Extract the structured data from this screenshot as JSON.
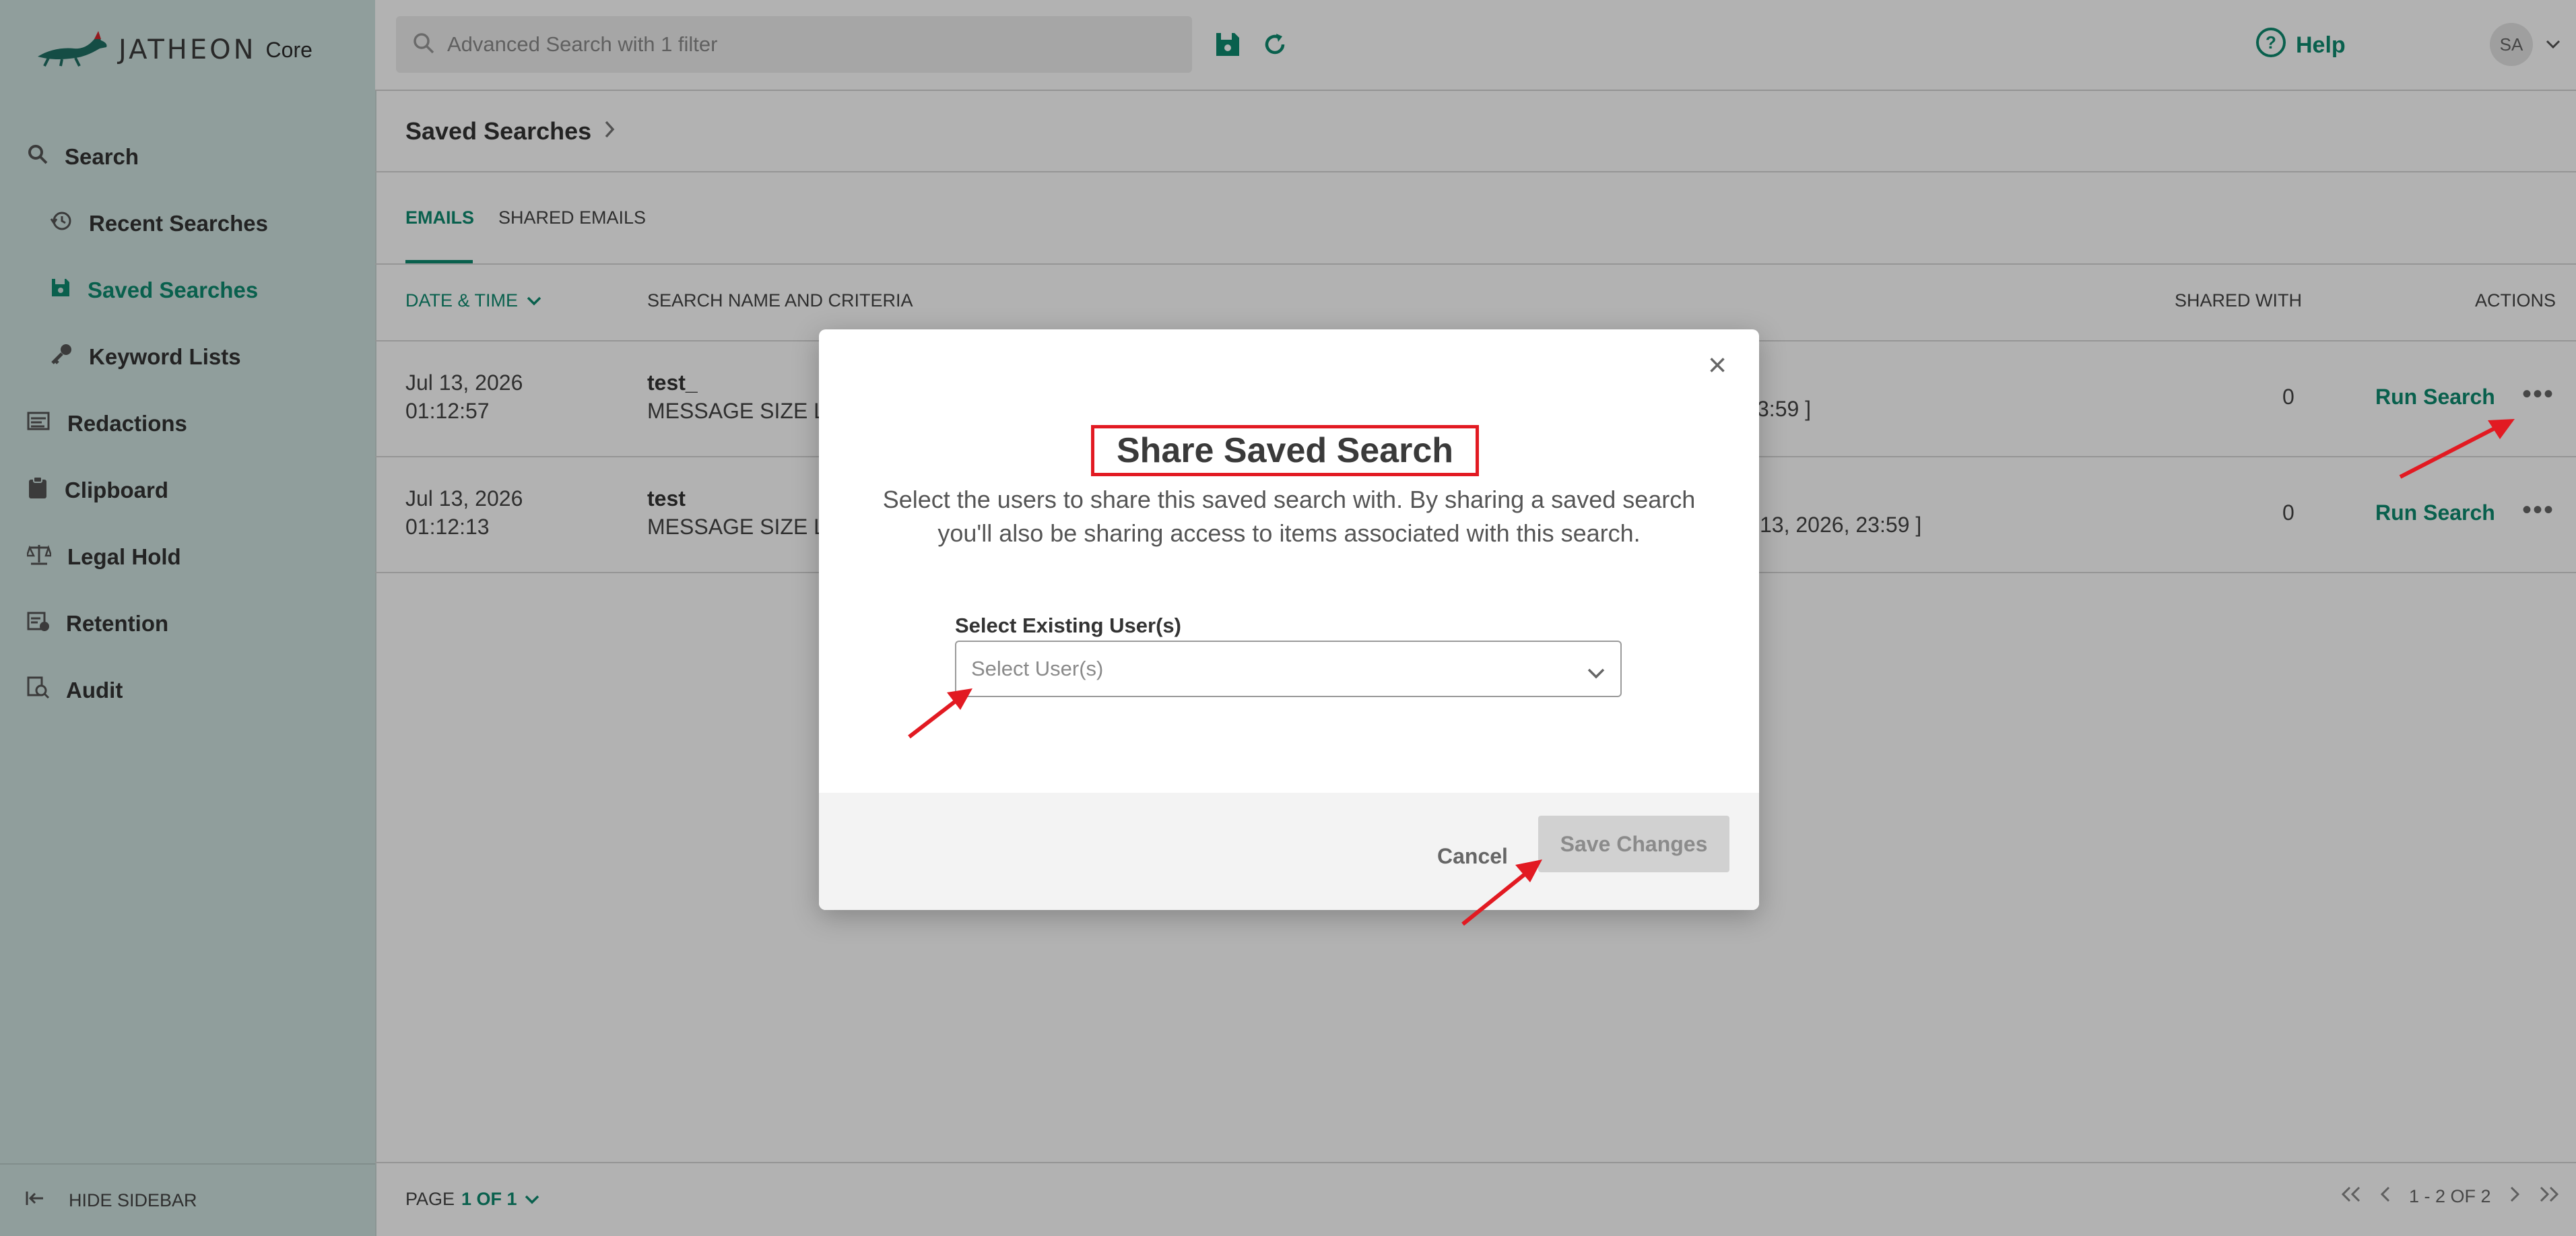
{
  "app": {
    "brand": "JATHEON",
    "product": "Core"
  },
  "sidebar": {
    "items": [
      {
        "label": "Search",
        "icon": "search-icon"
      },
      {
        "label": "Recent Searches",
        "icon": "history-icon"
      },
      {
        "label": "Saved Searches",
        "icon": "save-icon",
        "active": true
      },
      {
        "label": "Keyword Lists",
        "icon": "key-icon"
      },
      {
        "label": "Redactions",
        "icon": "redaction-icon"
      },
      {
        "label": "Clipboard",
        "icon": "clipboard-icon"
      },
      {
        "label": "Legal Hold",
        "icon": "scale-icon"
      },
      {
        "label": "Retention",
        "icon": "retention-icon"
      },
      {
        "label": "Audit",
        "icon": "audit-icon"
      }
    ],
    "hide_label": "HIDE SIDEBAR"
  },
  "topbar": {
    "search_placeholder": "Advanced Search with 1 filter",
    "help_label": "Help",
    "avatar_initials": "SA"
  },
  "breadcrumb": {
    "title": "Saved Searches"
  },
  "tabs": [
    {
      "label": "EMAILS",
      "active": true
    },
    {
      "label": "SHARED EMAILS",
      "active": false
    }
  ],
  "table": {
    "headers": {
      "date": "DATE & TIME",
      "name": "SEARCH NAME AND CRITERIA",
      "shared": "SHARED WITH",
      "actions": "ACTIONS"
    },
    "rows": [
      {
        "date": "Jul 13, 2026",
        "time": "01:12:57",
        "name": "test_",
        "criteria_head": "MESSAGE SIZE La",
        "criteria_tail": "3:59 ]",
        "shared": "0",
        "action": "Run Search"
      },
      {
        "date": "Jul 13, 2026",
        "time": "01:12:13",
        "name": "test",
        "criteria_head": "MESSAGE SIZE La",
        "criteria_tail": "13, 2026, 23:59 ]",
        "shared": "0",
        "action": "Run Search"
      }
    ]
  },
  "footer": {
    "page_label": "PAGE",
    "page_value": "1 OF 1",
    "range": "1 - 2 OF 2"
  },
  "modal": {
    "title": "Share Saved Search",
    "description": "Select the users to share this saved search with. By sharing a saved search you'll also be sharing access to items associated with this search.",
    "field_label": "Select Existing User(s)",
    "select_placeholder": "Select User(s)",
    "cancel_label": "Cancel",
    "save_label": "Save Changes"
  },
  "colors": {
    "accent": "#0e8a6f",
    "sidebar_bg": "#cfe3e0",
    "annotation": "#e21a22"
  }
}
